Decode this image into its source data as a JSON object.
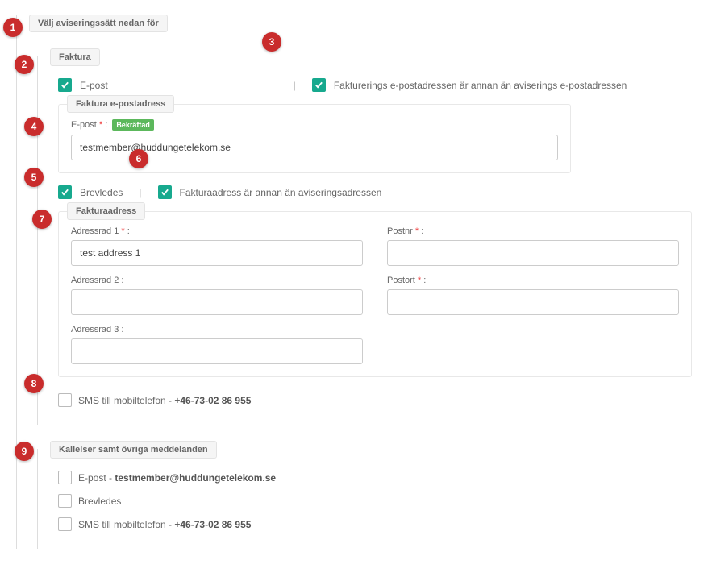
{
  "main": {
    "legend": "Välj aviseringssätt nedan för"
  },
  "faktura": {
    "legend": "Faktura",
    "epost": {
      "label": "E-post",
      "checked": true
    },
    "billing_email_different": {
      "label": "Fakturerings e-postadressen är annan än aviserings e-postadressen",
      "checked": true
    },
    "email_section": {
      "legend": "Faktura e-postadress",
      "field_label": "E-post",
      "badge": "Bekräftad",
      "value": "testmember@huddungetelekom.se"
    },
    "brevledes": {
      "label": "Brevledes",
      "checked": true
    },
    "invoice_address_different": {
      "label": "Fakturaadress är annan än aviseringsadressen",
      "checked": true
    },
    "address_section": {
      "legend": "Fakturaadress",
      "adressrad1": {
        "label": "Adressrad 1",
        "value": "test address 1",
        "required": true
      },
      "adressrad2": {
        "label": "Adressrad 2 :",
        "value": ""
      },
      "adressrad3": {
        "label": "Adressrad 3 :",
        "value": ""
      },
      "postnr": {
        "label": "Postnr",
        "value": "",
        "required": true
      },
      "postort": {
        "label": "Postort",
        "value": "",
        "required": true
      }
    },
    "sms": {
      "label_prefix": "SMS till mobiltelefon - ",
      "phone": "+46-73-02 86 955",
      "checked": false
    }
  },
  "kallelser": {
    "legend": "Kallelser samt övriga meddelanden",
    "epost": {
      "label_prefix": "E-post - ",
      "email": "testmember@huddungetelekom.se",
      "checked": false
    },
    "brevledes": {
      "label": "Brevledes",
      "checked": false
    },
    "sms": {
      "label_prefix": "SMS till mobiltelefon - ",
      "phone": "+46-73-02 86 955",
      "checked": false
    }
  },
  "markers": {
    "1": "1",
    "2": "2",
    "3": "3",
    "4": "4",
    "5": "5",
    "6": "6",
    "7": "7",
    "8": "8",
    "9": "9"
  }
}
